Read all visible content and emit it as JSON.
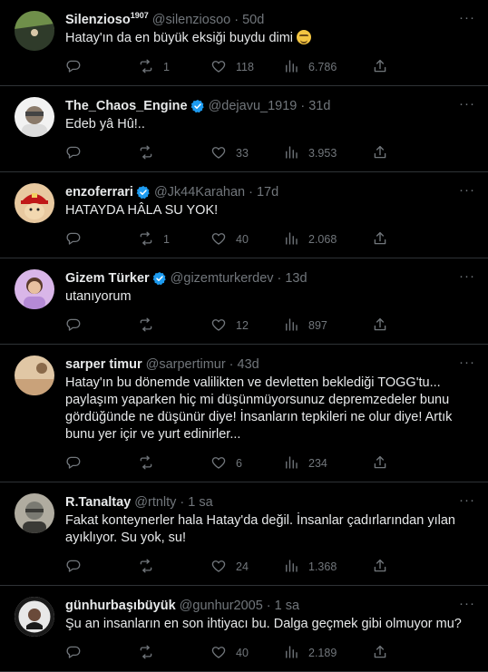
{
  "tweets": [
    {
      "name": "Silenzioso",
      "name_sup": "1907",
      "verified": false,
      "handle": "@silenziosoo",
      "time": "50d",
      "text": "Hatay'ın da en büyük eksiği buydu dimi",
      "has_emoji": true,
      "emoji_icon": "relieved-face-emoji",
      "counts": {
        "reply": "",
        "retweet": "1",
        "like": "118",
        "views": "6.786"
      },
      "avatar": {
        "kind": "photo-green",
        "colors": [
          "#2f3b2a",
          "#6f8f4a",
          "#1c2318"
        ]
      }
    },
    {
      "name": "The_Chaos_Engine",
      "name_sup": "",
      "verified": true,
      "handle": "@dejavu_1919",
      "time": "31d",
      "text": "Edeb yâ Hû!..",
      "has_emoji": false,
      "counts": {
        "reply": "",
        "retweet": "",
        "like": "33",
        "views": "3.953"
      },
      "avatar": {
        "kind": "photo-light",
        "colors": [
          "#dcdcdc",
          "#8a7a6a",
          "#f2f2f2"
        ]
      }
    },
    {
      "name": "enzoferrari",
      "name_sup": "",
      "verified": true,
      "handle": "@Jk44Karahan",
      "time": "17d",
      "text": "HATAYDA HÂLA SU YOK!",
      "has_emoji": false,
      "counts": {
        "reply": "",
        "retweet": "1",
        "like": "40",
        "views": "2.068"
      },
      "avatar": {
        "kind": "photo-red",
        "colors": [
          "#c01818",
          "#f2d8b0",
          "#e8c9a0"
        ]
      }
    },
    {
      "name": "Gizem Türker",
      "name_sup": "",
      "verified": true,
      "handle": "@gizemturkerdev",
      "time": "13d",
      "text": "utanıyorum",
      "has_emoji": false,
      "counts": {
        "reply": "",
        "retweet": "",
        "like": "12",
        "views": "897"
      },
      "avatar": {
        "kind": "photo-purple",
        "colors": [
          "#b58ad6",
          "#d9b6e8",
          "#5a3a2a"
        ]
      }
    },
    {
      "name": "sarper timur",
      "name_sup": "",
      "verified": false,
      "handle": "@sarpertimur",
      "time": "43d",
      "text": "Hatay'ın bu dönemde valilikten ve devletten beklediği TOGG'tu... paylaşım yaparken hiç mi düşünmüyorsunuz depremzedeler bunu gördüğünde ne düşünür diye! İnsanların tepkileri ne olur diye! Artık bunu yer içir ve yurt edinirler...",
      "has_emoji": false,
      "counts": {
        "reply": "",
        "retweet": "",
        "like": "6",
        "views": "234"
      },
      "avatar": {
        "kind": "photo-tan",
        "colors": [
          "#c9a27a",
          "#8a6a4a",
          "#e0c7a5"
        ]
      }
    },
    {
      "name": "R.Tanaltay",
      "name_sup": "",
      "verified": false,
      "handle": "@rtnlty",
      "time": "1 sa",
      "text": "Fakat konteynerler hala Hatay'da değil. İnsanlar çadırlarından yılan ayıklıyor. Su yok, su!",
      "has_emoji": false,
      "counts": {
        "reply": "",
        "retweet": "",
        "like": "24",
        "views": "1.368"
      },
      "avatar": {
        "kind": "photo-gray",
        "colors": [
          "#7a7a72",
          "#3a3a36",
          "#b0aca0"
        ]
      }
    },
    {
      "name": "günhurbaşıbüyük",
      "name_sup": "",
      "verified": false,
      "handle": "@gunhur2005",
      "time": "1 sa",
      "text": "Şu an insanların en son ihtiyacı bu. Dalga geçmek gibi olmuyor mu?",
      "has_emoji": false,
      "counts": {
        "reply": "",
        "retweet": "",
        "like": "40",
        "views": "2.189"
      },
      "avatar": {
        "kind": "photo-dark",
        "colors": [
          "#1a1a1a",
          "#e8e8e8",
          "#6a4a3a"
        ]
      }
    }
  ],
  "icons": {
    "reply": "reply-icon",
    "retweet": "retweet-icon",
    "like": "heart-icon",
    "views": "views-chart-icon",
    "share": "share-icon",
    "more": "more-dots-icon",
    "verified": "verified-badge-icon"
  },
  "colors": {
    "background": "#000000",
    "text": "#e7e9ea",
    "muted": "#71767b",
    "divider": "#2f3336",
    "verified": "#1d9bf0"
  }
}
